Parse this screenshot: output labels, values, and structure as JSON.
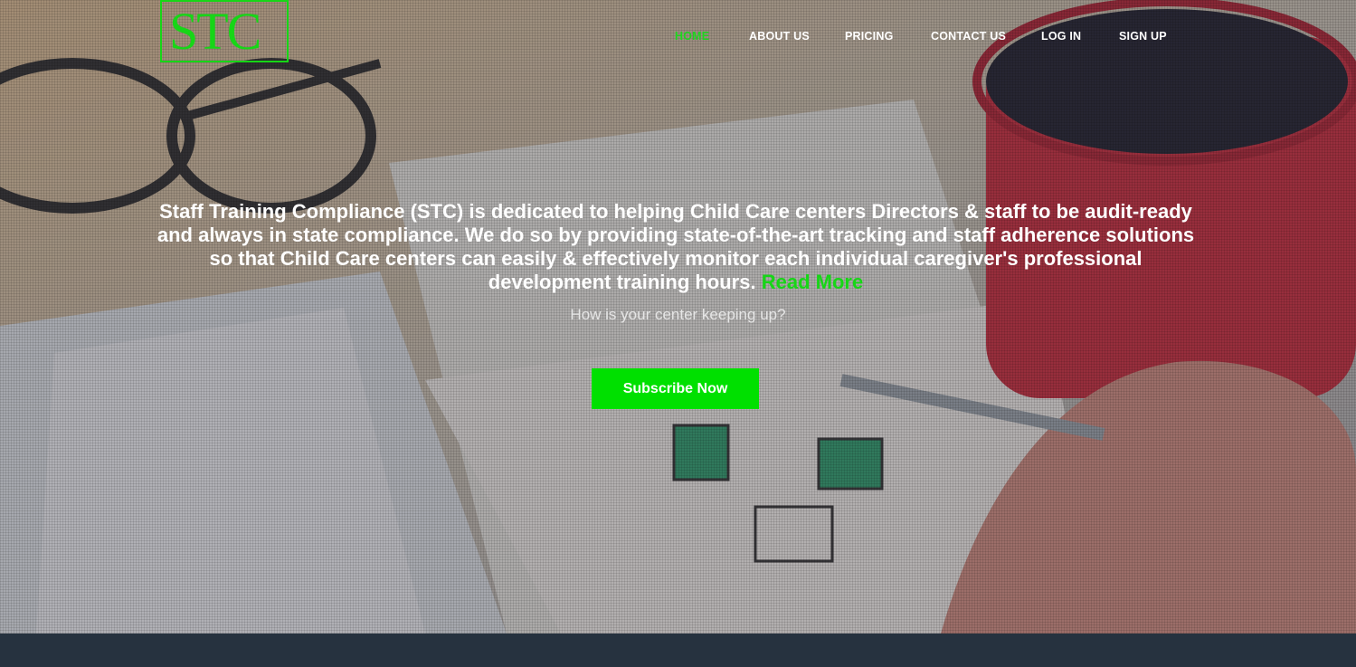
{
  "logo": {
    "text": "STC"
  },
  "nav": {
    "items": [
      {
        "label": "HOME",
        "active": true
      },
      {
        "label": "ABOUT US",
        "active": false
      },
      {
        "label": "PRICING",
        "active": false
      },
      {
        "label": "CONTACT US",
        "active": false
      },
      {
        "label": "LOG IN",
        "active": false
      },
      {
        "label": "SIGN UP",
        "active": false
      }
    ]
  },
  "hero": {
    "headline": "Staff Training Compliance (STC) is dedicated to helping Child Care centers Directors & staff to be audit-ready and always in state compliance. We do so by providing state-of-the-art tracking and staff adherence solutions so that Child Care centers can easily & effectively monitor each individual caregiver's professional development training hours.",
    "read_more": "Read More",
    "subline": "How is your center keeping up?",
    "cta_label": "Subscribe Now"
  },
  "colors": {
    "accent": "#00e000",
    "footer": "#26323f"
  }
}
